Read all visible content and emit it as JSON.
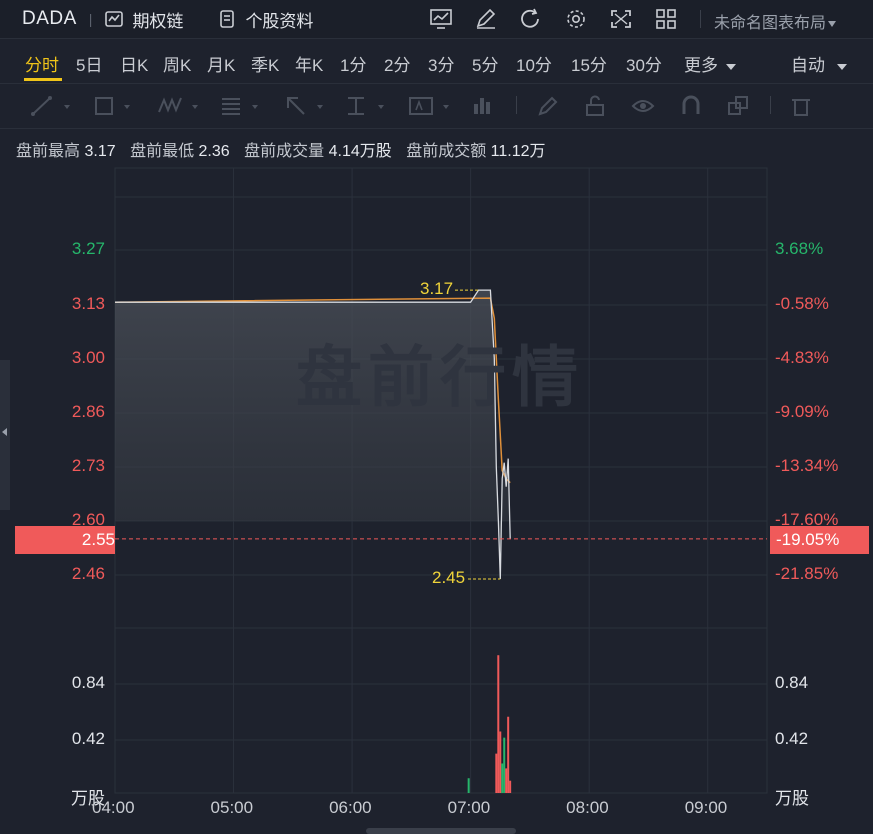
{
  "header": {
    "symbol": "DADA",
    "options_chain": "期权链",
    "stock_info": "个股资料",
    "layout_name": "未命名图表布局",
    "icons": [
      "chart-indicator-icon",
      "draw-pen-icon",
      "refresh-icon",
      "settings-gear-icon",
      "fullscreen-icon",
      "grid-layout-icon"
    ]
  },
  "tabs": {
    "items": [
      "分时",
      "5日",
      "日K",
      "周K",
      "月K",
      "季K",
      "年K",
      "1分",
      "2分",
      "3分",
      "5分",
      "10分",
      "15分",
      "30分",
      "更多"
    ],
    "active": "分时",
    "auto": "自动"
  },
  "info": {
    "high_label": "盘前最高",
    "high_value": "3.17",
    "low_label": "盘前最低",
    "low_value": "2.36",
    "vol_label": "盘前成交量",
    "vol_value": "4.14万股",
    "amt_label": "盘前成交额",
    "amt_value": "11.12万"
  },
  "watermark": "盘前行情",
  "chart_data": {
    "type": "line",
    "price_axis_left": [
      "3.27",
      "3.13",
      "3.00",
      "2.86",
      "2.73",
      "2.60",
      "2.46"
    ],
    "price_axis_right": [
      "3.68%",
      "-0.58%",
      "-4.83%",
      "-9.09%",
      "-13.34%",
      "-17.60%",
      "-21.85%"
    ],
    "volume_axis_left": [
      "0.84",
      "0.42",
      "万股"
    ],
    "volume_axis_right": [
      "0.84",
      "0.42",
      "万股"
    ],
    "time_axis": [
      "04:00",
      "05:00",
      "06:00",
      "07:00",
      "08:00",
      "09:00"
    ],
    "ylim": [
      2.4,
      3.36
    ],
    "high_mark": "3.17",
    "low_mark": "2.45",
    "current_price": "2.55",
    "current_change": "-19.05%",
    "price_series": [
      {
        "t": "04:00",
        "p": 3.14
      },
      {
        "t": "07:00",
        "p": 3.14
      },
      {
        "t": "07:04",
        "p": 3.17
      },
      {
        "t": "07:10",
        "p": 3.17
      },
      {
        "t": "07:12",
        "p": 3.0
      },
      {
        "t": "07:13",
        "p": 2.73
      },
      {
        "t": "07:14",
        "p": 2.6
      },
      {
        "t": "07:15",
        "p": 2.45
      },
      {
        "t": "07:16",
        "p": 2.7
      },
      {
        "t": "07:17",
        "p": 2.74
      },
      {
        "t": "07:18",
        "p": 2.68
      },
      {
        "t": "07:19",
        "p": 2.75
      },
      {
        "t": "07:20",
        "p": 2.55
      }
    ],
    "avg_series": [
      {
        "t": "04:00",
        "p": 3.14
      },
      {
        "t": "07:10",
        "p": 3.15
      },
      {
        "t": "07:12",
        "p": 3.1
      },
      {
        "t": "07:14",
        "p": 2.9
      },
      {
        "t": "07:16",
        "p": 2.72
      },
      {
        "t": "07:18",
        "p": 2.7
      },
      {
        "t": "07:20",
        "p": 2.69
      }
    ],
    "volume_series": [
      {
        "t": "06:59",
        "v": 0.12,
        "dir": "up"
      },
      {
        "t": "07:13",
        "v": 0.32,
        "dir": "down"
      },
      {
        "t": "07:14",
        "v": 1.12,
        "dir": "down"
      },
      {
        "t": "07:15",
        "v": 0.5,
        "dir": "down"
      },
      {
        "t": "07:16",
        "v": 0.24,
        "dir": "up"
      },
      {
        "t": "07:17",
        "v": 0.45,
        "dir": "up"
      },
      {
        "t": "07:18",
        "v": 0.2,
        "dir": "down"
      },
      {
        "t": "07:19",
        "v": 0.62,
        "dir": "down"
      },
      {
        "t": "07:20",
        "v": 0.1,
        "dir": "down"
      }
    ],
    "colors": {
      "up": "#26b66b",
      "down": "#f05a5a",
      "price_line": "#d8dbe0",
      "avg_line": "#e0903a",
      "hl": "#f0d43a"
    }
  }
}
